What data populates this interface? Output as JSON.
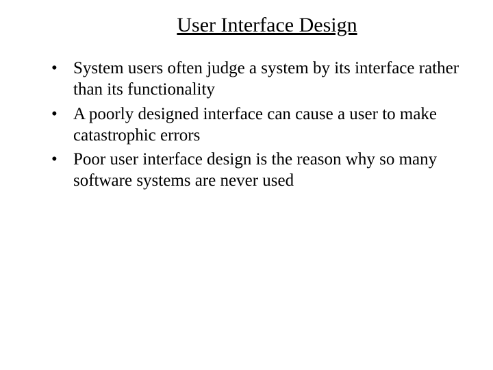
{
  "slide": {
    "title": "User Interface Design",
    "bullets": [
      "System users often judge a system by its interface rather than its functionality",
      "A poorly designed interface can cause a user to make catastrophic errors",
      "Poor user interface design is the reason why so many software systems are never used"
    ]
  }
}
